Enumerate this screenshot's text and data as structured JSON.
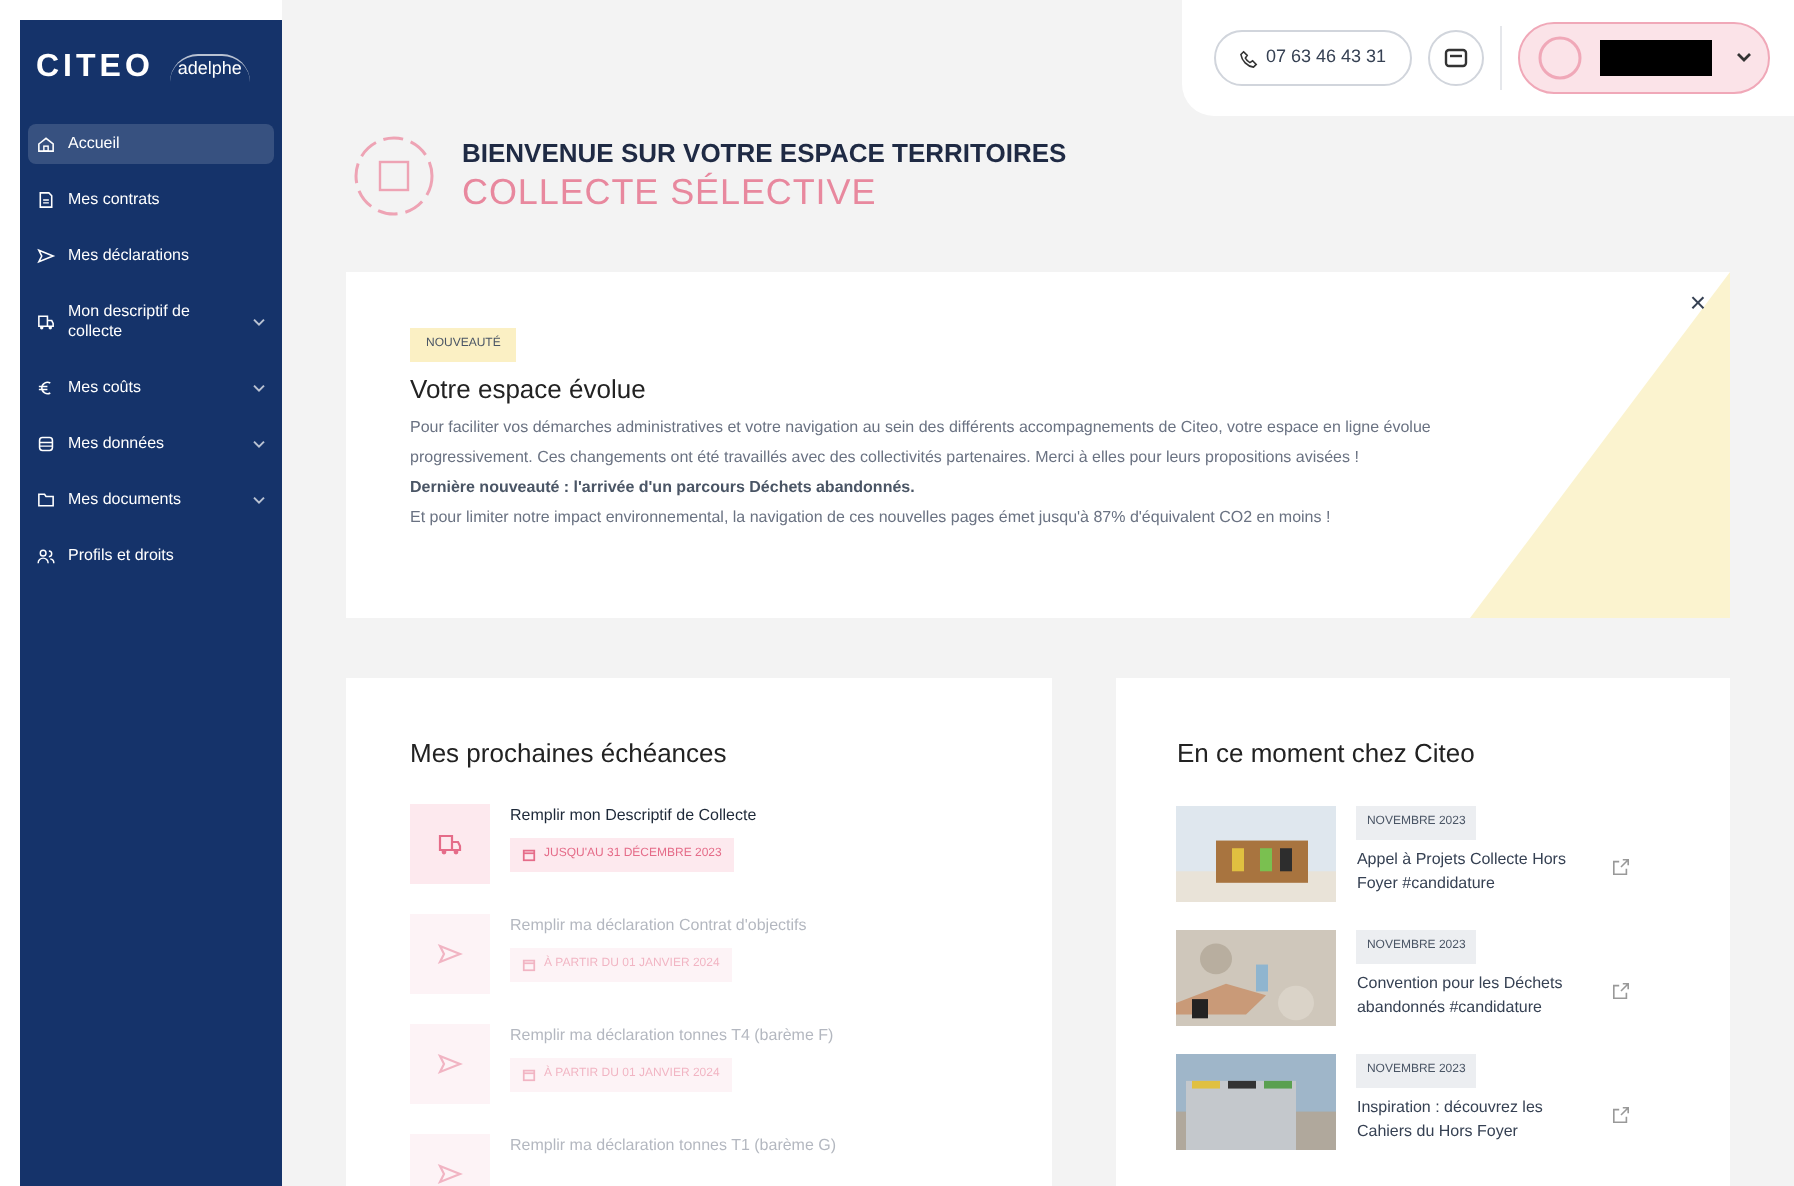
{
  "sidebar": {
    "logo": "CITEO",
    "sub_logo": "adelphe",
    "items": [
      {
        "label": "Accueil",
        "kind": "home",
        "selected": true,
        "expandable": false
      },
      {
        "label": "Mes contrats",
        "kind": "doc",
        "selected": false,
        "expandable": false
      },
      {
        "label": "Mes déclarations",
        "kind": "send",
        "selected": false,
        "expandable": false
      },
      {
        "label": "Mon descriptif de collecte",
        "kind": "truck",
        "selected": false,
        "expandable": true
      },
      {
        "label": "Mes coûts",
        "kind": "euro",
        "selected": false,
        "expandable": true
      },
      {
        "label": "Mes données",
        "kind": "db",
        "selected": false,
        "expandable": true
      },
      {
        "label": "Mes documents",
        "kind": "folder",
        "selected": false,
        "expandable": true
      },
      {
        "label": "Profils et droits",
        "kind": "users",
        "selected": false,
        "expandable": false
      }
    ]
  },
  "topbar": {
    "phone": "07 63 46 43 31"
  },
  "header": {
    "title": "BIENVENUE SUR VOTRE ESPACE TERRITOIRES",
    "subtitle": "COLLECTE SÉLECTIVE"
  },
  "banner": {
    "badge": "NOUVEAUTÉ",
    "title": "Votre espace évolue",
    "close": "×",
    "text": "Pour faciliter vos démarches administratives et votre navigation au sein des différents accompagnements de Citeo, votre espace en ligne évolue progressivement. Ces changements ont été travaillés avec des collectivités partenaires. Merci à elles pour leurs propositions avisées !",
    "highlight": "Dernière nouveauté : l'arrivée d'un parcours Déchets abandonnés.",
    "footer": "Et pour limiter notre impact environnemental, la navigation de ces nouvelles pages émet jusqu'à 87% d'équivalent CO2 en moins !"
  },
  "deadlines": {
    "title": "Mes prochaines échéances",
    "items": [
      {
        "kind": "truck",
        "label": "Remplir mon Descriptif de Collecte",
        "date": "JUSQU'AU 31 DÉCEMBRE 2023",
        "active": true
      },
      {
        "kind": "send",
        "label": "Remplir ma déclaration Contrat d'objectifs",
        "date": "À PARTIR DU 01 JANVIER 2024",
        "active": false
      },
      {
        "kind": "send",
        "label": "Remplir ma déclaration tonnes T4 (barème F)",
        "date": "À PARTIR DU 01 JANVIER 2024",
        "active": false
      },
      {
        "kind": "send",
        "label": "Remplir ma déclaration tonnes T1 (barème G)",
        "active": false
      }
    ]
  },
  "news": {
    "title": "En ce moment chez Citeo",
    "items": [
      {
        "date": "NOVEMBRE 2023",
        "label": "Appel à Projets Collecte Hors Foyer #candidature"
      },
      {
        "date": "NOVEMBRE 2023",
        "label": "Convention pour les Déchets abandonnés #candidature"
      },
      {
        "date": "NOVEMBRE 2023",
        "label": "Inspiration : découvrez les Cahiers du Hors Foyer"
      }
    ]
  }
}
